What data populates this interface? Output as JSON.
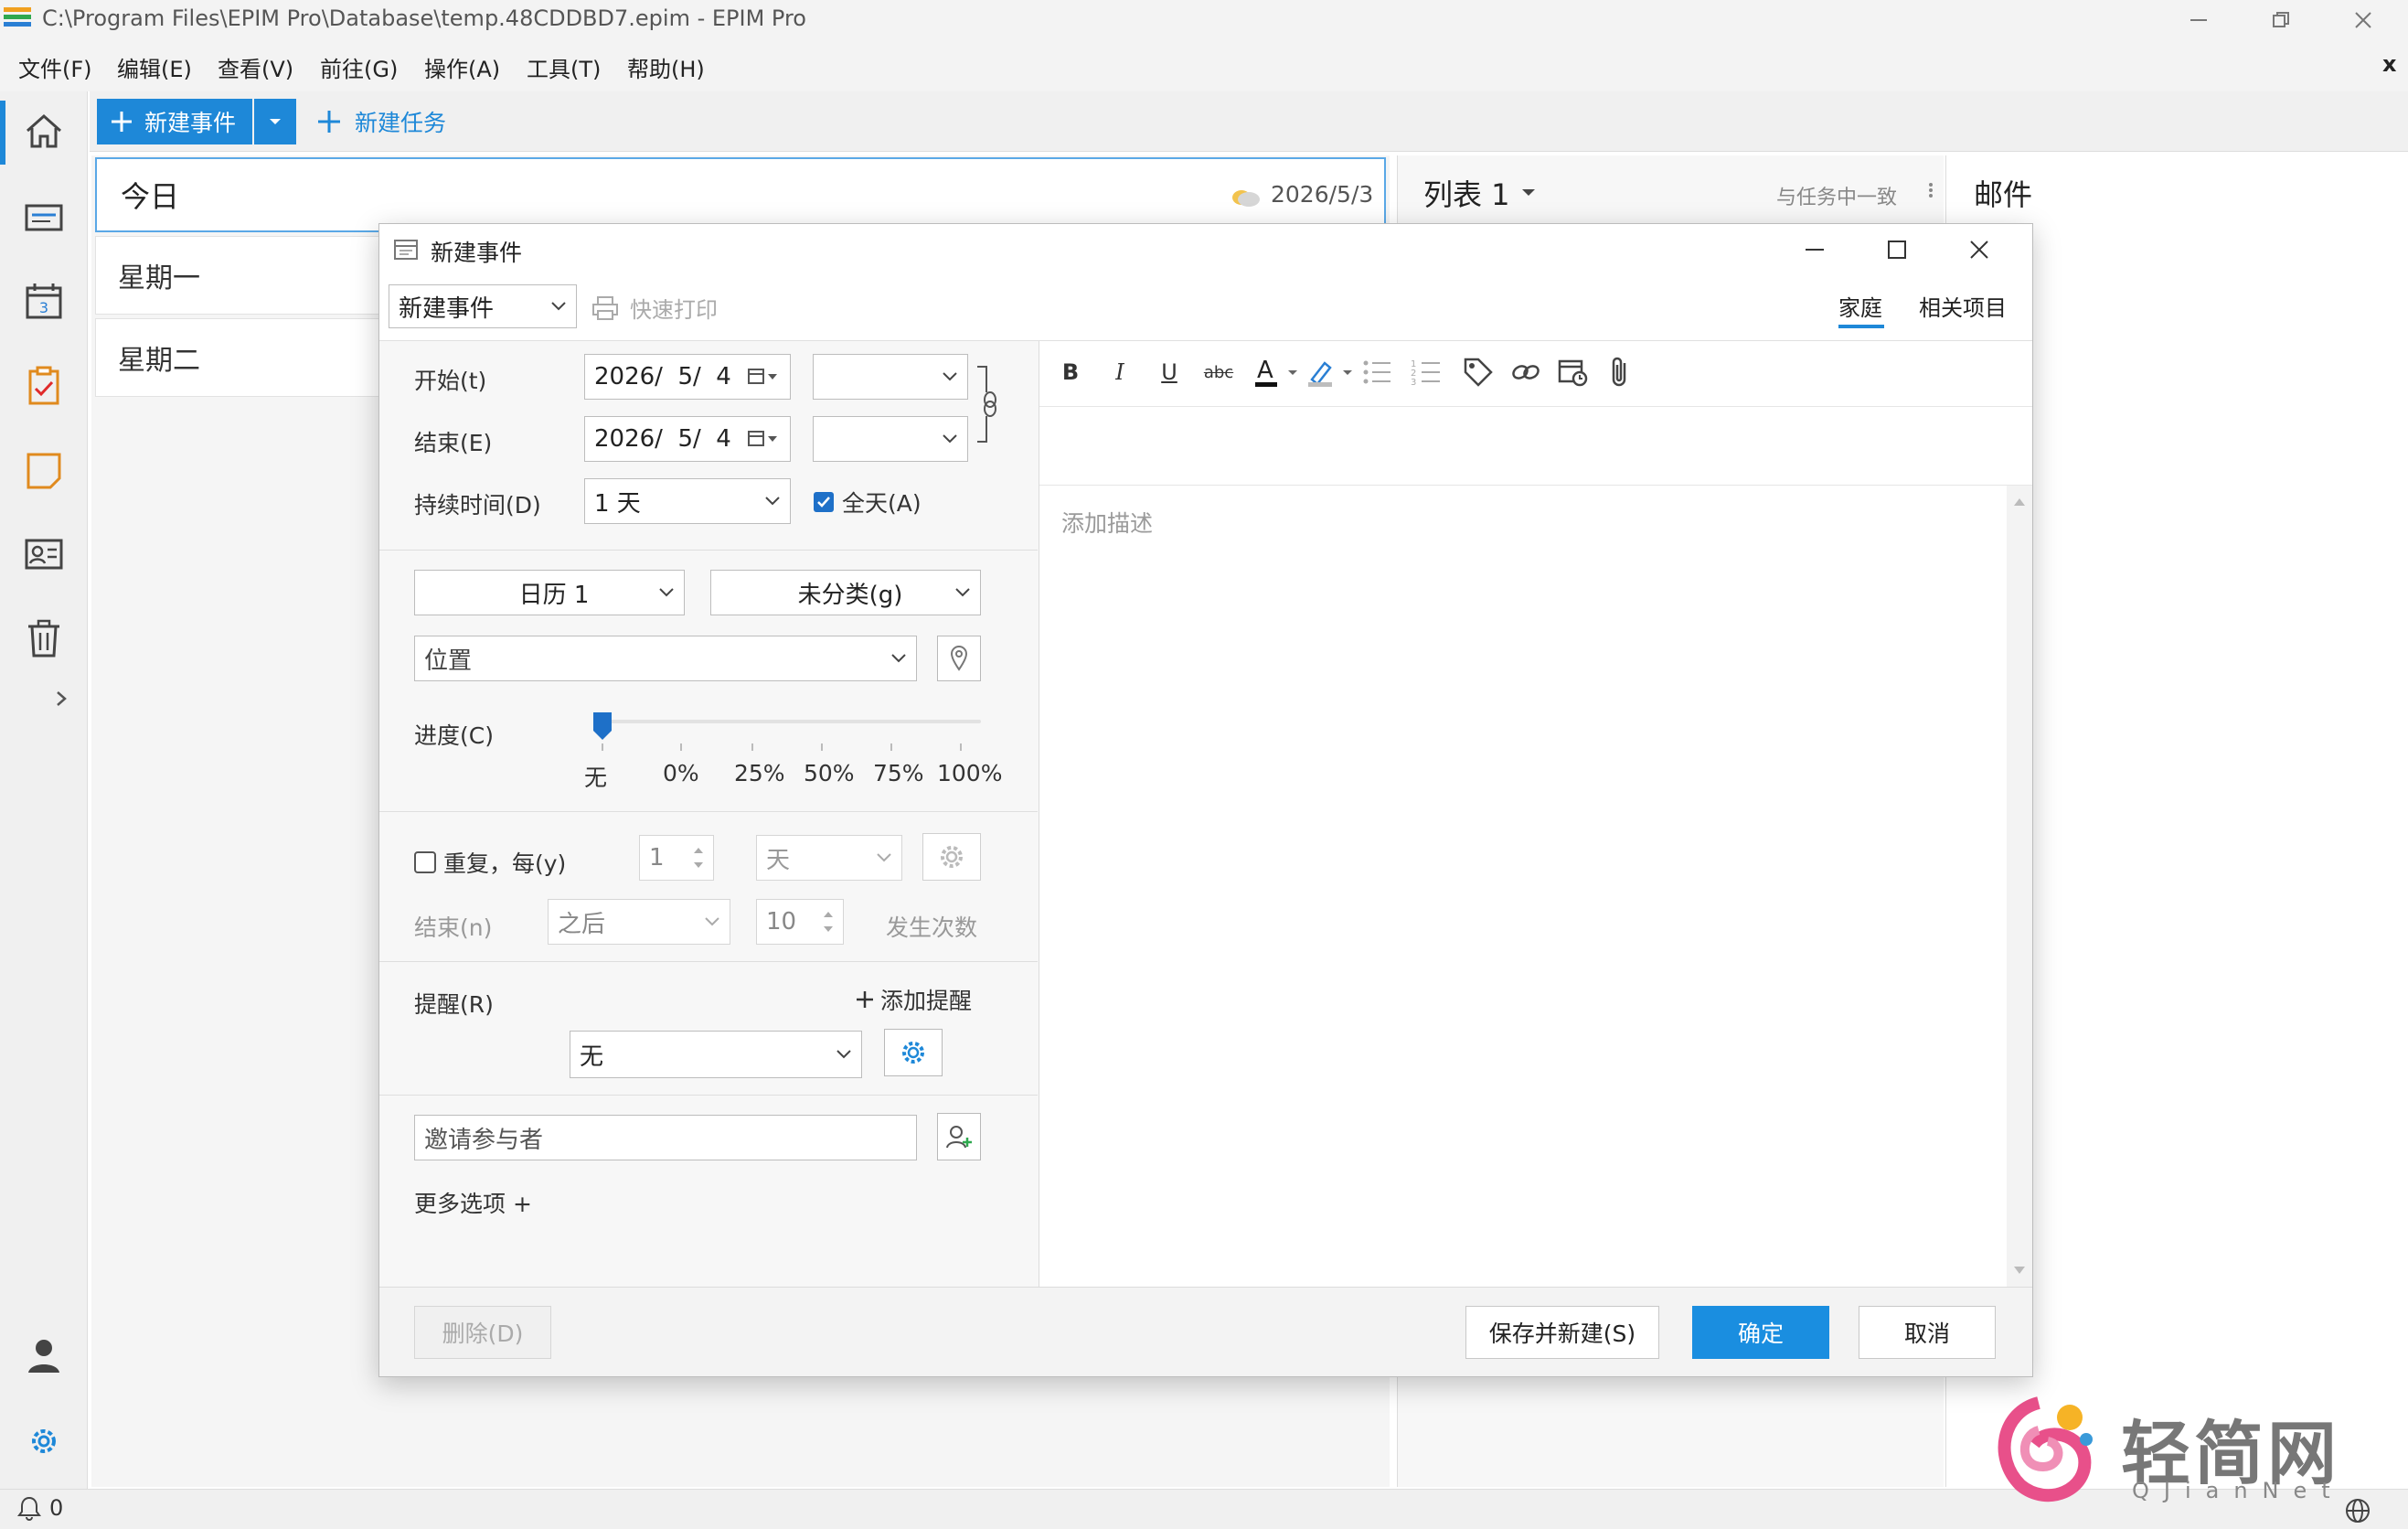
{
  "window": {
    "title": "C:\\Program Files\\EPIM Pro\\Database\\temp.48CDDBD7.epim - EPIM Pro"
  },
  "menu": [
    "文件(F)",
    "编辑(E)",
    "查看(V)",
    "前往(G)",
    "操作(A)",
    "工具(T)",
    "帮助(H)"
  ],
  "menu_close": "x",
  "toolbar": {
    "new_event": "新建事件",
    "new_task": "新建任务"
  },
  "today": {
    "title": "今日",
    "date": "2026/5/3",
    "days": [
      "星期一",
      "星期二"
    ]
  },
  "list_panel": {
    "title": "列表 1",
    "filter": "与任务中一致"
  },
  "mail_panel": {
    "title": "邮件"
  },
  "status": {
    "count": "0"
  },
  "dialog": {
    "title": "新建事件",
    "type_select": "新建事件",
    "quick_print": "快速打印",
    "tabs": [
      "家庭",
      "相关项目"
    ],
    "start_label": "开始(t)",
    "start_date": "2026/  5/  4",
    "end_label": "结束(E)",
    "end_date": "2026/  5/  4",
    "duration_label": "持续时间(D)",
    "duration_value": "1 天",
    "allday_label": "全天(A)",
    "calendar_value": "日历 1",
    "category_value": "未分类(g)",
    "location_placeholder": "位置",
    "progress_label": "进度(C)",
    "progress_ticks": [
      "无",
      "0%",
      "25%",
      "50%",
      "75%",
      "100%"
    ],
    "repeat_label": "重复，每(y)",
    "repeat_count": "1",
    "repeat_unit": "天",
    "end_n_label": "结束(n)",
    "end_n_value": "之后",
    "occurrences_value": "10",
    "occurrences_label": "发生次数",
    "reminder_label": "提醒(R)",
    "add_reminder": "添加提醒",
    "reminder_value": "无",
    "invite_placeholder": "邀请参与者",
    "more_options": "更多选项 +",
    "description_placeholder": "添加描述",
    "delete_button": "删除(D)",
    "save_new_button": "保存并新建(S)",
    "ok_button": "确定",
    "cancel_button": "取消"
  },
  "watermark": {
    "cn": "轻简网",
    "en": "QJianNet"
  },
  "colors": {
    "accent": "#1e88d8",
    "primary_button": "#1a8ee0"
  }
}
